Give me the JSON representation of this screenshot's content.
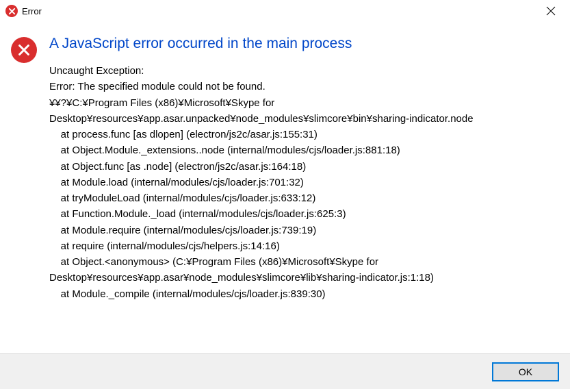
{
  "titlebar": {
    "title": "Error"
  },
  "dialog": {
    "heading": "A JavaScript error occurred in the main process",
    "body": "Uncaught Exception:\nError: The specified module could not be found.\n¥¥?¥C:¥Program Files (x86)¥Microsoft¥Skype for\nDesktop¥resources¥app.asar.unpacked¥node_modules¥slimcore¥bin¥sharing-indicator.node\n    at process.func [as dlopen] (electron/js2c/asar.js:155:31)\n    at Object.Module._extensions..node (internal/modules/cjs/loader.js:881:18)\n    at Object.func [as .node] (electron/js2c/asar.js:164:18)\n    at Module.load (internal/modules/cjs/loader.js:701:32)\n    at tryModuleLoad (internal/modules/cjs/loader.js:633:12)\n    at Function.Module._load (internal/modules/cjs/loader.js:625:3)\n    at Module.require (internal/modules/cjs/loader.js:739:19)\n    at require (internal/modules/cjs/helpers.js:14:16)\n    at Object.<anonymous> (C:¥Program Files (x86)¥Microsoft¥Skype for\nDesktop¥resources¥app.asar¥node_modules¥slimcore¥lib¥sharing-indicator.js:1:18)\n    at Module._compile (internal/modules/cjs/loader.js:839:30)"
  },
  "buttons": {
    "ok": "OK"
  }
}
